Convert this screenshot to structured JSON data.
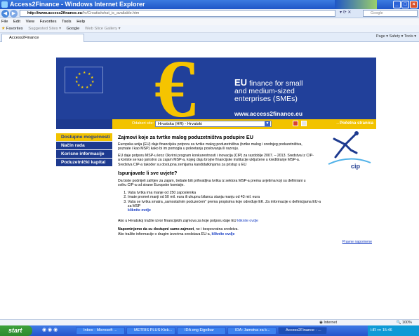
{
  "window": {
    "title": "Access2Finance - Windows Internet Explorer"
  },
  "address": {
    "url_host": "http://www.access2finance.eu",
    "url_rest": "/hr/Croatia/what_is_available.htm",
    "search_placeholder": "Google"
  },
  "menu": [
    "File",
    "Edit",
    "View",
    "Favorites",
    "Tools",
    "Help"
  ],
  "favorites": {
    "label": "Favorites",
    "items": [
      "Suggested Sites ▾",
      "Google",
      "Web Slice Gallery ▾"
    ]
  },
  "tab": {
    "label": "Access2Finance",
    "tools": "Page ▾  Safety ▾  Tools ▾"
  },
  "banner": {
    "eu": "EU",
    "line1": "finance for small",
    "line2": "and medium-sized",
    "line3": "enterprises (SMEs)",
    "url": "www.access2finance.eu"
  },
  "lang": {
    "label": "Odaberi site:",
    "selected": "Hrvatska (HR) - Hrvatski",
    "home": "→Početna stranica"
  },
  "sidebar": {
    "items": [
      "Dostupne mogućnosti",
      "Način rada",
      "Korisne informacije",
      "Poduzetnički kapital"
    ]
  },
  "content": {
    "title": "Zajmovi koje za tvrtke malog poduzetništva podupire EU",
    "intro": "Europska unija (EU) daje financijsku potporu za tvrtke malog poduzetništva (tvrtke malog i srednjeg poduzetništva, poznate i kao MSP) kako bi im pomogla u pokretanju poslovanja ili razvoju.",
    "para2": "EU daje potporu MSP-u kroz Okvirni program konkurentnosti i inovacija (CIP) za razdoblje 2007. – 2013. Sredstva iz CIP-a koriste se kao jamstvo za zajam MSP-a, kojeg daju brojne financijske institucije uključene u kreditiranje MSP-a. Sredstva CIP-a također su dostupna zemljama kandidatkinjama za pristup u EU",
    "subtitle": "Ispunjavate li sve uvjete?",
    "para3": "Da biste podnijeli zahtjev za zajam, trebate biti prihvatljiva tvrtka iz sektora MSP-a prema uvjetima koji su definirani u svihu CIP-a od strane Europske komisije.",
    "list": [
      "Vaša tvrtka ima manje od 250 zaposlenika",
      "Imate promet manji od 50 mil. eura ili ukupnu bilancu stanja manju od 43 mil. eura",
      "Vaša se tvrtka smatra „samostalnim poduzećem\" prema propisima koje određuje EK. Za informacije o definicijama EU-a za MSP"
    ],
    "list_link": "kliknite ovdje",
    "para4": "Ako u Hrvatskoj tražite izvor financijskih zajmova za koje potporu daje EU",
    "para4_link": "kliknite ovdje",
    "note_bold": "Napominjemo da su dostupni samo zajmovi",
    "note_rest": ", ne i bespovratna sredstva.",
    "note2": "Ako tražite informacije o drugim izvorima sredstava EU-a,",
    "note2_link": "kliknite ovdje",
    "legal": "Pravne napomene",
    "cip": "cip"
  },
  "status": {
    "zone": "Internet",
    "zoom": "100%"
  },
  "taskbar": {
    "start": "start",
    "buttons": [
      "Inbox - Microsoft ...",
      "METRIS PLUS Kick...",
      "IDA eng Eigolbar",
      "IDA: Jamstva za k...",
      "Access2Finance - ..."
    ],
    "tray": "HR",
    "clock": "15:46"
  }
}
